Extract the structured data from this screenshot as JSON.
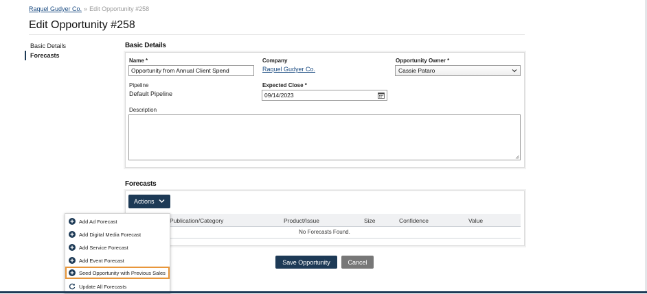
{
  "breadcrumb": {
    "parent": "Raquel Gudyer Co.",
    "separator": "»",
    "current": "Edit Opportunity #258"
  },
  "page_title": "Edit Opportunity #258",
  "side_nav": {
    "items": [
      {
        "label": "Basic Details",
        "active": false
      },
      {
        "label": "Forecasts",
        "active": true
      }
    ]
  },
  "basic_details": {
    "section_title": "Basic Details",
    "name_label": "Name *",
    "name_value": "Opportunity from Annual Client Spend",
    "company_label": "Company",
    "company_value": "Raquel Gudyer Co.",
    "owner_label": "Opportunity Owner *",
    "owner_value": "Cassie Pataro",
    "pipeline_label": "Pipeline",
    "pipeline_value": "Default Pipeline",
    "expected_close_label": "Expected Close *",
    "expected_close_value": "09/14/2023",
    "description_label": "Description",
    "description_value": ""
  },
  "forecasts": {
    "section_title": "Forecasts",
    "actions_label": "Actions",
    "columns": [
      "Publication/Category",
      "Product/Issue",
      "Size",
      "Confidence",
      "Value"
    ],
    "empty_message": "No Forecasts Found."
  },
  "actions_menu": {
    "items": [
      {
        "label": "Add Ad Forecast",
        "icon": "plus-circle-icon"
      },
      {
        "label": "Add Digital Media Forecast",
        "icon": "plus-circle-icon"
      },
      {
        "label": "Add Service Forecast",
        "icon": "plus-circle-icon"
      },
      {
        "label": "Add Event Forecast",
        "icon": "plus-circle-icon"
      },
      {
        "label": "Seed Opportunity with Previous Sales",
        "icon": "plus-circle-icon"
      },
      {
        "label": "Update All Forecasts",
        "icon": "refresh-icon"
      }
    ]
  },
  "footer_buttons": {
    "save_label": "Save Opportunity",
    "cancel_label": "Cancel"
  },
  "colors": {
    "primary": "#1d3a56",
    "link": "#1b4c82",
    "highlight": "#e8963a",
    "secondary_button": "#777777"
  }
}
